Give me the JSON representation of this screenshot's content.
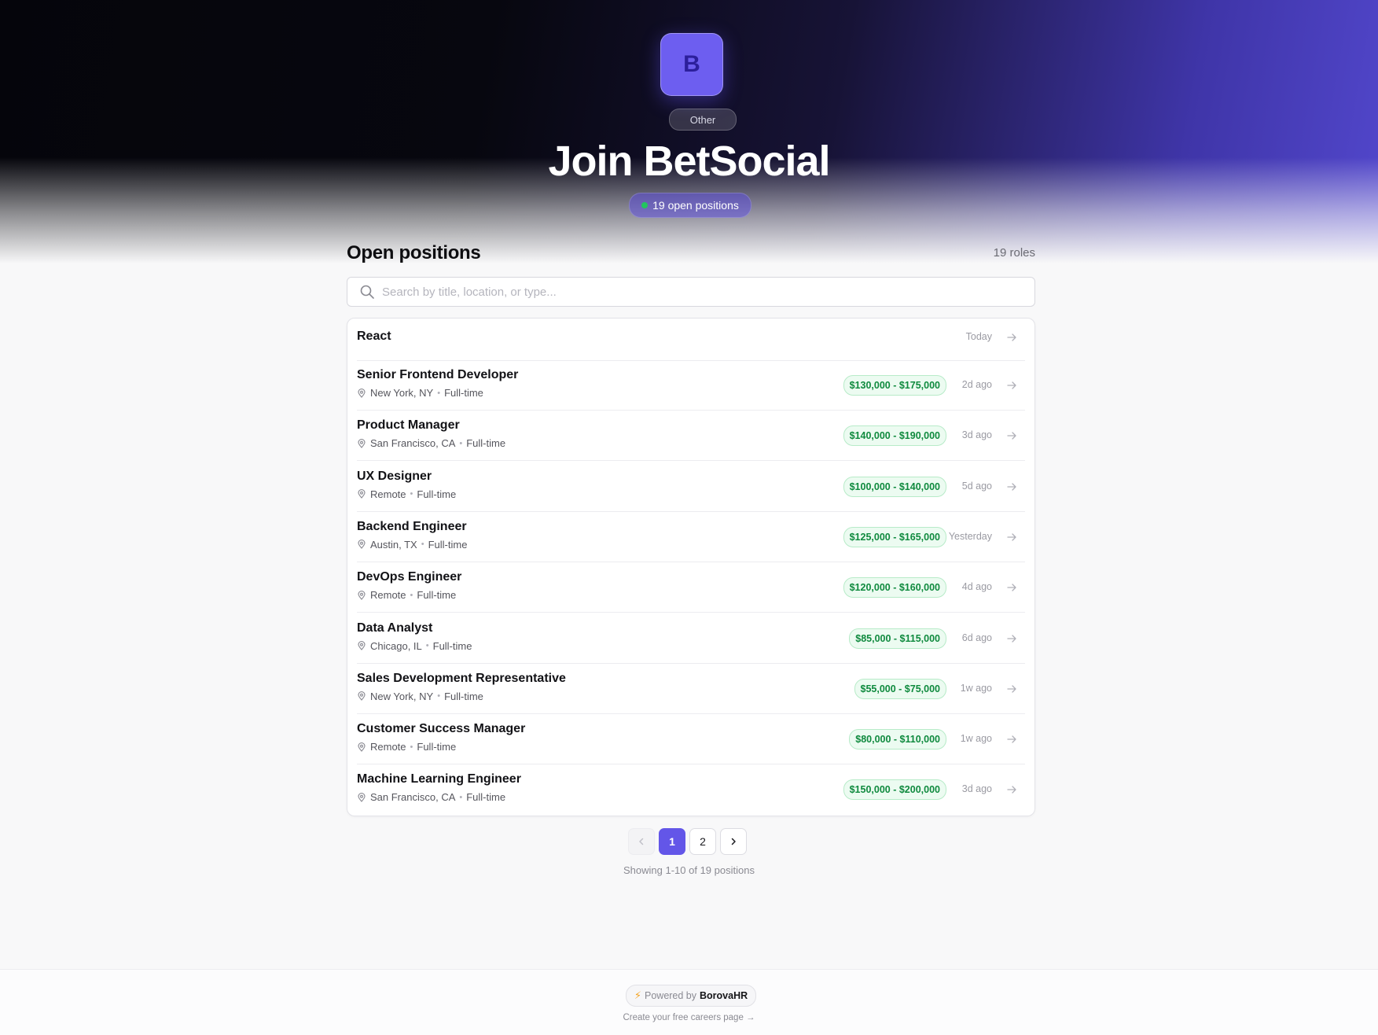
{
  "hero": {
    "logo_letter": "B",
    "industry_tag": "Other",
    "title": "Join BetSocial",
    "open_positions_label": "19 open positions"
  },
  "listing": {
    "section_title": "Open positions",
    "roles_count": "19 roles",
    "search_placeholder": "Search by title, location, or type...",
    "jobs": [
      {
        "title": "React",
        "location": "",
        "type": "",
        "salary": "",
        "posted": "Today"
      },
      {
        "title": "Senior Frontend Developer",
        "location": "New York, NY",
        "type": "Full-time",
        "salary": "$130,000 - $175,000",
        "posted": "2d ago"
      },
      {
        "title": "Product Manager",
        "location": "San Francisco, CA",
        "type": "Full-time",
        "salary": "$140,000 - $190,000",
        "posted": "3d ago"
      },
      {
        "title": "UX Designer",
        "location": "Remote",
        "type": "Full-time",
        "salary": "$100,000 - $140,000",
        "posted": "5d ago"
      },
      {
        "title": "Backend Engineer",
        "location": "Austin, TX",
        "type": "Full-time",
        "salary": "$125,000 - $165,000",
        "posted": "Yesterday"
      },
      {
        "title": "DevOps Engineer",
        "location": "Remote",
        "type": "Full-time",
        "salary": "$120,000 - $160,000",
        "posted": "4d ago"
      },
      {
        "title": "Data Analyst",
        "location": "Chicago, IL",
        "type": "Full-time",
        "salary": "$85,000 - $115,000",
        "posted": "6d ago"
      },
      {
        "title": "Sales Development Representative",
        "location": "New York, NY",
        "type": "Full-time",
        "salary": "$55,000 - $75,000",
        "posted": "1w ago"
      },
      {
        "title": "Customer Success Manager",
        "location": "Remote",
        "type": "Full-time",
        "salary": "$80,000 - $110,000",
        "posted": "1w ago"
      },
      {
        "title": "Machine Learning Engineer",
        "location": "San Francisco, CA",
        "type": "Full-time",
        "salary": "$150,000 - $200,000",
        "posted": "3d ago"
      }
    ]
  },
  "pagination": {
    "pages": [
      "1",
      "2"
    ],
    "current_page": "1",
    "showing_text": "Showing 1-10 of 19 positions"
  },
  "footer": {
    "powered_prefix": "Powered by",
    "brand": "BorovaHR",
    "bolt_icon": "⚡",
    "create_link": "Create your free careers page →"
  },
  "colors": {
    "accent": "#6356e8",
    "salary_text": "#0f8a3e",
    "salary_bg": "#ecfbf1",
    "status_dot": "#22c55e"
  },
  "icons": [
    "search-icon",
    "location-pin-icon",
    "arrow-right-icon",
    "chevron-left-icon",
    "chevron-right-icon",
    "bolt-icon"
  ]
}
